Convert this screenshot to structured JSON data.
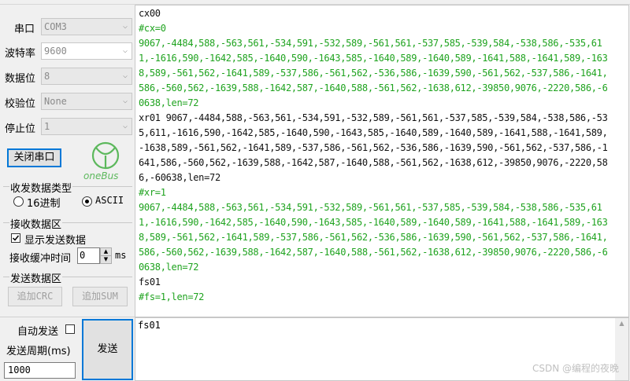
{
  "settings": {
    "port_label": "串口",
    "port_value": "COM3",
    "baud_label": "波特率",
    "baud_value": "9600",
    "databits_label": "数据位",
    "databits_value": "8",
    "parity_label": "校验位",
    "parity_value": "None",
    "stopbits_label": "停止位",
    "stopbits_value": "1"
  },
  "toolbar": {
    "close_port_label": "关闭串口",
    "logo_text": "oneBus"
  },
  "recv_type": {
    "title": "收发数据类型",
    "hex_label": "16进制",
    "ascii_label": "ASCII",
    "selected": "ASCII"
  },
  "recv_area": {
    "title": "接收数据区",
    "show_send_label": "显示发送数据",
    "show_send_checked": true,
    "buffer_label": "接收缓冲时间",
    "buffer_value": "0",
    "buffer_unit": "ms"
  },
  "send_area": {
    "title": "发送数据区",
    "add_crc_label": "追加CRC",
    "add_sum_label": "追加SUM"
  },
  "auto_send": {
    "label": "自动发送",
    "checked": false,
    "period_label": "发送周期(ms)",
    "period_value": "1000",
    "send_label": "发送"
  },
  "received_lines": [
    {
      "text": "cx00",
      "color": "#111111"
    },
    {
      "text": "#cx=0",
      "color": "#1fa31f"
    },
    {
      "text": "9067,-4484,588,-563,561,-534,591,-532,589,-561,561,-537,585,-539,584,-538,586,-535,611,-1616,590,-1642,585,-1640,590,-1643,585,-1640,589,-1640,589,-1641,588,-1641,589,-1638,589,-561,562,-1641,589,-537,586,-561,562,-536,586,-1639,590,-561,562,-537,586,-1641,586,-560,562,-1639,588,-1642,587,-1640,588,-561,562,-1638,612,-39850,9076,-2220,586,-60638,len=72",
      "color": "#1fa31f"
    },
    {
      "text": "xr01 9067,-4484,588,-563,561,-534,591,-532,589,-561,561,-537,585,-539,584,-538,586,-535,611,-1616,590,-1642,585,-1640,590,-1643,585,-1640,589,-1640,589,-1641,588,-1641,589,-1638,589,-561,562,-1641,589,-537,586,-561,562,-536,586,-1639,590,-561,562,-537,586,-1641,586,-560,562,-1639,588,-1642,587,-1640,588,-561,562,-1638,612,-39850,9076,-2220,586,-60638,len=72",
      "color": "#111111"
    },
    {
      "text": "#xr=1",
      "color": "#1fa31f"
    },
    {
      "text": "9067,-4484,588,-563,561,-534,591,-532,589,-561,561,-537,585,-539,584,-538,586,-535,611,-1616,590,-1642,585,-1640,590,-1643,585,-1640,589,-1640,589,-1641,588,-1641,589,-1638,589,-561,562,-1641,589,-537,586,-561,562,-536,586,-1639,590,-561,562,-537,586,-1641,586,-560,562,-1639,588,-1642,587,-1640,588,-561,562,-1638,612,-39850,9076,-2220,586,-60638,len=72",
      "color": "#1fa31f"
    },
    {
      "text": "fs01",
      "color": "#111111"
    },
    {
      "text": "#fs=1,len=72",
      "color": "#1fa31f"
    }
  ],
  "send_text": "fs01",
  "watermark": "CSDN @编程的夜晚"
}
